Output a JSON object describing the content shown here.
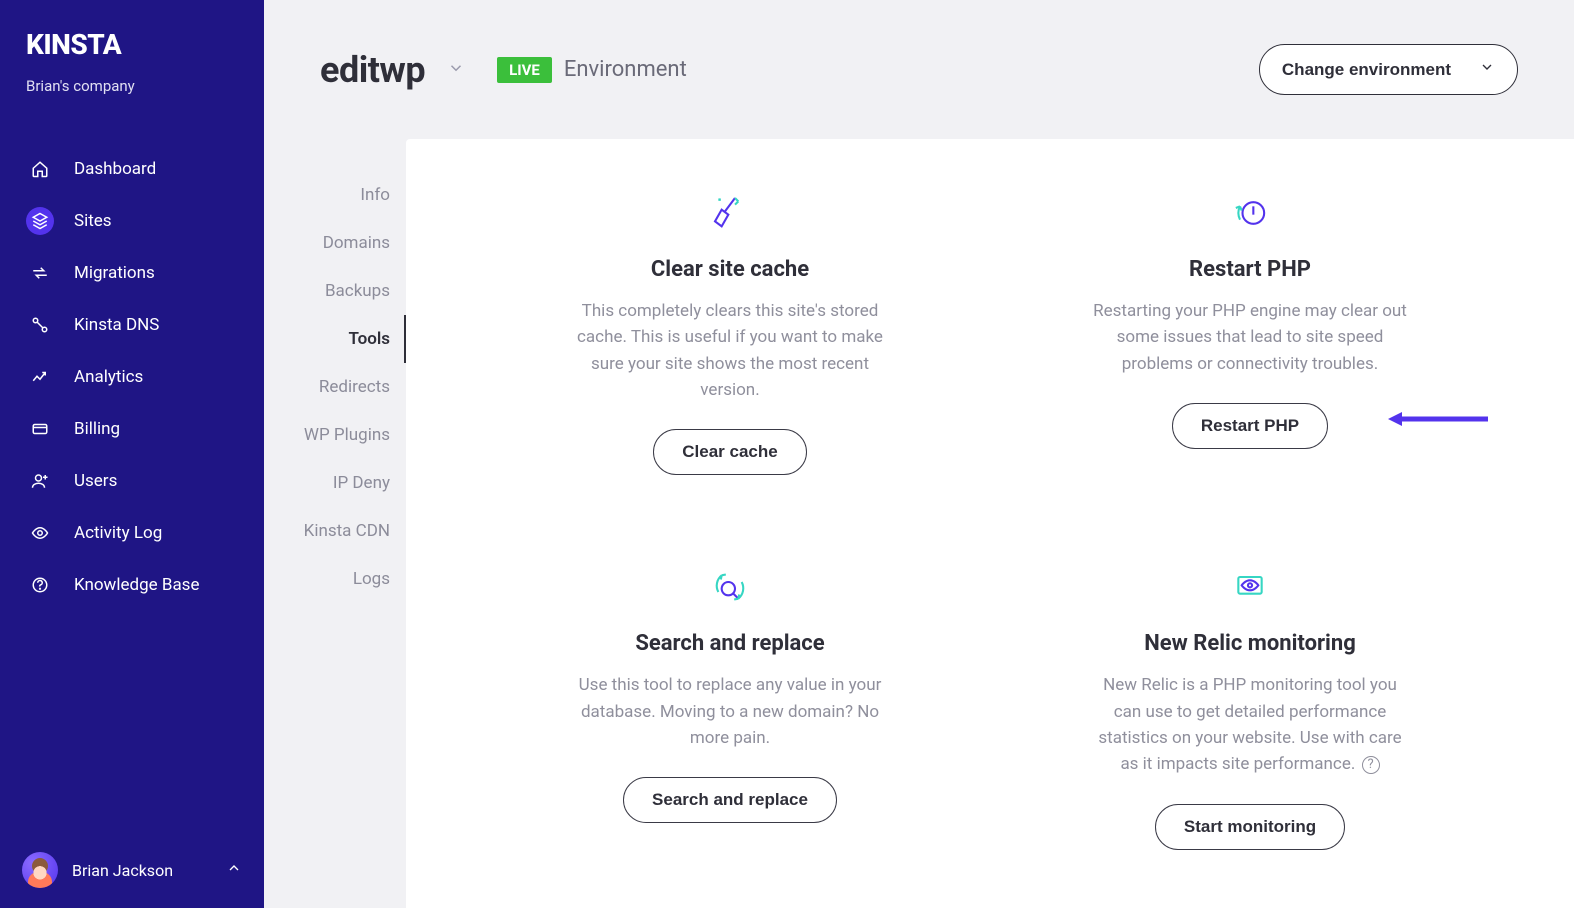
{
  "brand": "KINSTA",
  "company": "Brian's company",
  "nav": [
    {
      "label": "Dashboard",
      "icon": "home"
    },
    {
      "label": "Sites",
      "icon": "stack",
      "active": true
    },
    {
      "label": "Migrations",
      "icon": "arrows"
    },
    {
      "label": "Kinsta DNS",
      "icon": "dns"
    },
    {
      "label": "Analytics",
      "icon": "chart"
    },
    {
      "label": "Billing",
      "icon": "card"
    },
    {
      "label": "Users",
      "icon": "user-plus"
    },
    {
      "label": "Activity Log",
      "icon": "eye"
    },
    {
      "label": "Knowledge Base",
      "icon": "help"
    }
  ],
  "user": {
    "name": "Brian Jackson"
  },
  "site": {
    "name": "editwp",
    "live_badge": "LIVE",
    "env_label": "Environment",
    "change_env": "Change environment"
  },
  "submenu": [
    {
      "label": "Info"
    },
    {
      "label": "Domains"
    },
    {
      "label": "Backups"
    },
    {
      "label": "Tools",
      "active": true
    },
    {
      "label": "Redirects"
    },
    {
      "label": "WP Plugins"
    },
    {
      "label": "IP Deny"
    },
    {
      "label": "Kinsta CDN"
    },
    {
      "label": "Logs"
    }
  ],
  "tools": {
    "clear_cache": {
      "title": "Clear site cache",
      "desc": "This completely clears this site's stored cache. This is useful if you want to make sure your site shows the most recent version.",
      "button": "Clear cache"
    },
    "restart_php": {
      "title": "Restart PHP",
      "desc": "Restarting your PHP engine may clear out some issues that lead to site speed problems or connectivity troubles.",
      "button": "Restart PHP"
    },
    "search_replace": {
      "title": "Search and replace",
      "desc": "Use this tool to replace any value in your database. Moving to a new domain? No more pain.",
      "button": "Search and replace"
    },
    "new_relic": {
      "title": "New Relic monitoring",
      "desc": "New Relic is a PHP monitoring tool you can use to get detailed performance statistics on your website. Use with care as it impacts site performance.",
      "button": "Start monitoring"
    }
  },
  "colors": {
    "sidebar": "#1f1585",
    "accent": "#5333ed",
    "live": "#3bbf3b",
    "teal": "#36d6c3"
  }
}
